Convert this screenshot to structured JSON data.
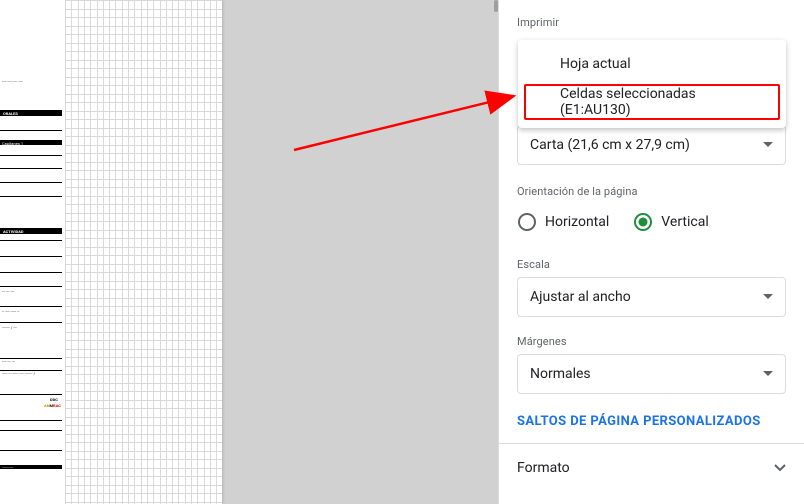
{
  "print": {
    "label": "Imprimir",
    "menu": {
      "current": "Hoja actual",
      "selected": "Celdas seleccionadas (E1:AU130)"
    }
  },
  "paper": {
    "value": "Carta (21,6 cm x 27,9 cm)"
  },
  "orientation": {
    "label": "Orientación de la página",
    "horizontal": "Horizontal",
    "vertical": "Vertical"
  },
  "scale": {
    "label": "Escala",
    "value": "Ajustar al ancho"
  },
  "margins": {
    "label": "Márgenes",
    "value": "Normales"
  },
  "page_breaks": "SALTOS DE PÁGINA PERSONALIZADOS",
  "format": {
    "label": "Formato"
  },
  "doc_labels": {
    "orales": "ORALES",
    "actividad": "ACTIVIDAD"
  }
}
